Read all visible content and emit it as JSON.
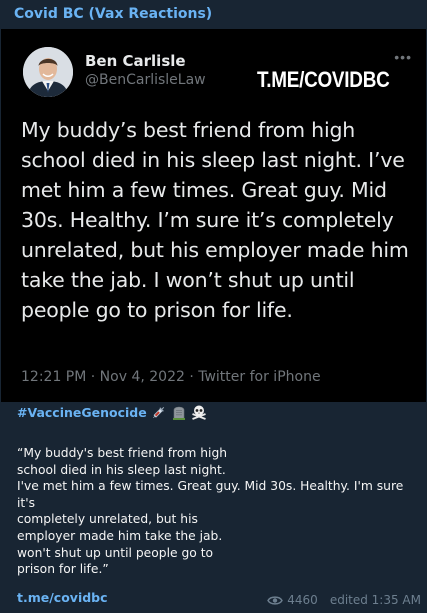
{
  "channel": {
    "title": "Covid BC (Vax Reactions)",
    "link": "t.me/covidbc"
  },
  "tweet": {
    "author_name": "Ben Carlisle",
    "author_handle": "@BenCarlisleLaw",
    "more_icon": "more-dots-icon",
    "watermark": "T.ME/COVIDBC",
    "text": "My buddy’s best friend from high school died in his sleep last night. I’ve met him a few times. Great guy. Mid 30s. Healthy. I’m sure it’s completely unrelated, but his employer made him take the jab. I won’t shut up until people go to prison for life.",
    "meta": "12:21 PM · Nov 4, 2022 · Twitter for iPhone"
  },
  "message": {
    "hashtag": "#VaccineGenocide",
    "emojis": [
      "syringe-icon",
      "headstone-icon",
      "skull-crossbones-icon"
    ],
    "quote": "“My buddy's best friend from high\nschool died in his sleep last night.\nI've met him a few times. Great guy. Mid 30s. Healthy. I'm sure it's\ncompletely unrelated, but his\nemployer made him take the jab.\nwon't shut up until people go to\nprison for life.”",
    "views": "4460",
    "edited": "edited 1:35 AM"
  },
  "colors": {
    "background": "#182533",
    "accent": "#6ab3f3",
    "tweet_background": "#000000",
    "muted": "#71767b"
  }
}
